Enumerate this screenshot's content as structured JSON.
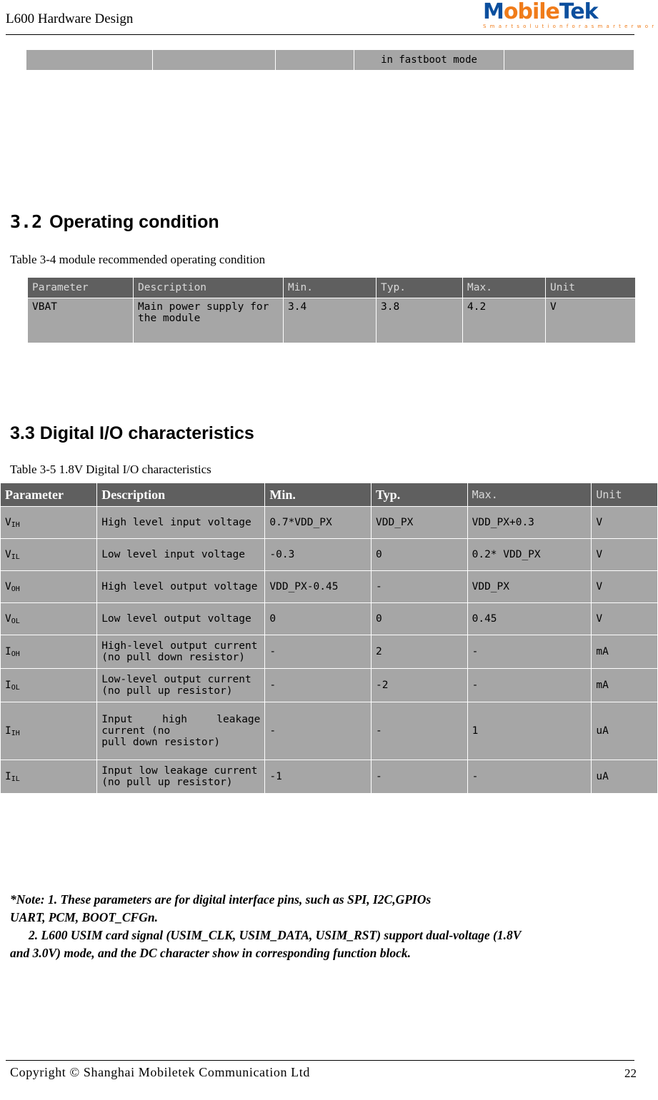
{
  "header": {
    "title": "L600 Hardware Design",
    "logo": {
      "part1": "M",
      "part2": "obile",
      "part3": "Tek",
      "tagline": "S m a r t   s o l u t i o n   f o r   a   s m a r t e r   w o r l d"
    }
  },
  "top_table": {
    "cells": [
      "",
      "",
      "",
      "in fastboot mode",
      ""
    ]
  },
  "sections": {
    "s32_number": "3.2",
    "s32_title": "Operating condition",
    "s33_title": "3.3 Digital I/O characteristics"
  },
  "table_3_4": {
    "caption": "Table 3-4 module recommended operating condition",
    "headers": [
      "Parameter",
      "Description",
      "Min.",
      "Typ.",
      "Max.",
      "Unit"
    ],
    "rows": [
      {
        "parameter": "VBAT",
        "description_line1": "Main power supply for",
        "description_line2": "the module",
        "min": "3.4",
        "typ": "3.8",
        "max": "4.2",
        "unit": "V"
      }
    ]
  },
  "table_3_5": {
    "caption": "Table 3-5 1.8V Digital I/O characteristics",
    "headers": [
      "Parameter",
      "Description",
      "Min.",
      "Typ.",
      "Max.",
      "Unit"
    ],
    "rows": [
      {
        "param_base": "V",
        "param_sub": "IH",
        "description": "High level input voltage",
        "min": "0.7*VDD_PX",
        "typ": "VDD_PX",
        "max": "VDD_PX+0.3",
        "unit": "V"
      },
      {
        "param_base": "V",
        "param_sub": "IL",
        "description": "Low level input voltage",
        "min": "-0.3",
        "typ": "0",
        "max": "0.2* VDD_PX",
        "unit": "V"
      },
      {
        "param_base": "V",
        "param_sub": "OH",
        "description": "High level output voltage",
        "min": "VDD_PX-0.45",
        "typ": "-",
        "max": "VDD_PX",
        "unit": "V"
      },
      {
        "param_base": "V",
        "param_sub": "OL",
        "description": "Low level output voltage",
        "min": "0",
        "typ": "0",
        "max": "0.45",
        "unit": "V"
      },
      {
        "param_base": "I",
        "param_sub": "OH",
        "description_line1": "High-level output current",
        "description_line2": "(no pull down resistor)",
        "min": "-",
        "typ": "2",
        "max": "-",
        "unit": "mA"
      },
      {
        "param_base": "I",
        "param_sub": "OL",
        "description_line1": "Low-level output current",
        "description_line2": "(no pull up resistor)",
        "min": "-",
        "typ": "-2",
        "max": "-",
        "unit": "mA"
      },
      {
        "param_base": "I",
        "param_sub": "IH",
        "description_line1": "Input high leakage",
        "description_line2": "current (no",
        "description_line3": "pull down resistor)",
        "min": "-",
        "typ": "-",
        "max": "1",
        "unit": "uA"
      },
      {
        "param_base": "I",
        "param_sub": "IL",
        "description_line1": "Input low leakage current",
        "description_line2": "(no pull up resistor)",
        "min": "-1",
        "typ": "-",
        "max": "-",
        "unit": "uA"
      }
    ]
  },
  "notes": {
    "line1": "*Note: 1. These parameters are for digital interface pins, such as SPI, I2C,GPIOs",
    "line2": "UART, PCM, BOOT_CFGn.",
    "line3": "2. L600 USIM card signal (USIM_CLK, USIM_DATA, USIM_RST) support dual-voltage (1.8V",
    "line4": "and 3.0V) mode, and the DC character show in corresponding function block."
  },
  "footer": {
    "copyright": "Copyright  ©  Shanghai  Mobiletek  Communication  Ltd",
    "page": "22"
  }
}
